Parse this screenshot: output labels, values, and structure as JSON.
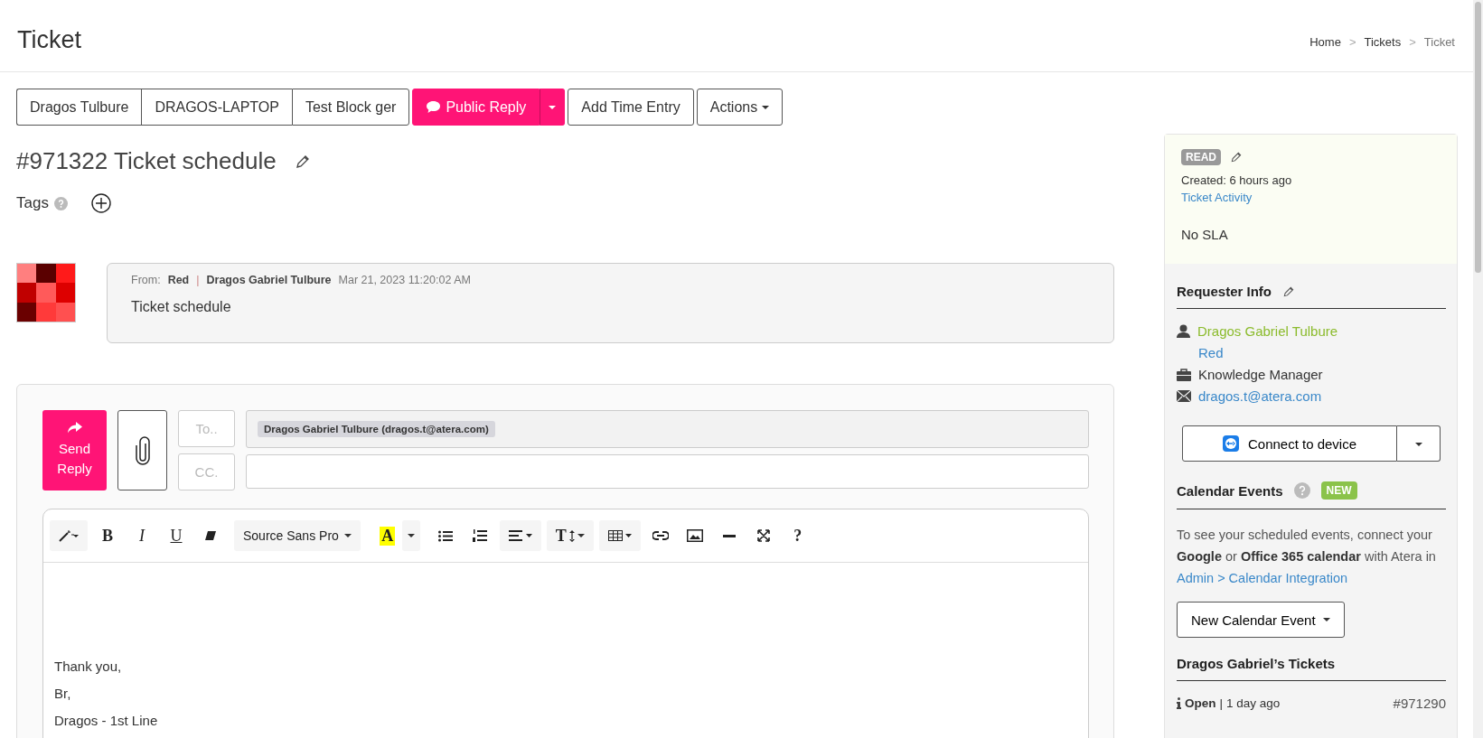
{
  "header": {
    "title": "Ticket",
    "breadcrumb": [
      {
        "label": "Home",
        "current": false
      },
      {
        "label": "Tickets",
        "current": false
      },
      {
        "label": "Ticket",
        "current": true
      }
    ],
    "separator": ">"
  },
  "toolbar": [
    {
      "label": "Dragos Tulbure",
      "kind": "group"
    },
    {
      "label": "DRAGOS-LAPTOP",
      "kind": "group"
    },
    {
      "label": "Test Block ger",
      "kind": "group"
    },
    {
      "label": "Public Reply",
      "kind": "primary"
    },
    {
      "label": "Add Time Entry",
      "kind": "plain"
    },
    {
      "label": "Actions",
      "kind": "dropdown"
    }
  ],
  "ticket": {
    "title": "#971322 Ticket schedule",
    "tags_label": "Tags"
  },
  "message": {
    "from_label": "From:",
    "from": "Red",
    "separator": "|",
    "author": "Dragos Gabriel Tulbure",
    "time": "Mar 21, 2023 11:20:02 AM",
    "body": "Ticket schedule"
  },
  "reply": {
    "send": "Send Reply",
    "to_placeholder": "To..",
    "cc_placeholder": "CC.",
    "recipients": [
      "Dragos Gabriel Tulbure (dragos.t@atera.com)"
    ],
    "toolbar": {
      "bold": "B",
      "italic": "I",
      "underline": "U",
      "font": "Source Sans Pro",
      "highlight": "A",
      "text_size": "T",
      "help": "?"
    },
    "lines": [
      "Thank you,",
      "Br,",
      "Dragos - 1st Line"
    ]
  },
  "side": {
    "status": "READ",
    "created": "Created: 6 hours ago",
    "activity": "Ticket Activity",
    "sla": "No SLA",
    "requester": {
      "heading": "Requester Info",
      "name": "Dragos Gabriel Tulbure",
      "org": "Red",
      "role": "Knowledge Manager",
      "email": "dragos.t@atera.com"
    },
    "connect": "Connect to device",
    "calendar": {
      "heading": "Calendar Events",
      "badge": "NEW",
      "text": "To see your scheduled events, connect your **Google** or **Office 365 calendar** with Atera in ",
      "link": "Admin > Calendar Integration",
      "button": "New Calendar Event"
    },
    "tickets": {
      "heading": "Dragos Gabriel’s Tickets",
      "items": [
        {
          "status": "Open",
          "separator": "|",
          "age": "1 day ago",
          "number": "#971290"
        }
      ]
    }
  }
}
